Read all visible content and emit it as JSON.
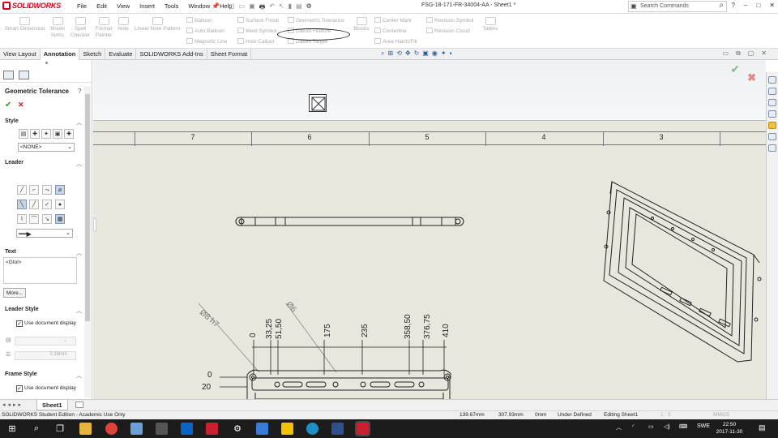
{
  "app": {
    "logo": "SOLIDWORKS",
    "menu": [
      "File",
      "Edit",
      "View",
      "Insert",
      "Tools",
      "Window",
      "Help"
    ],
    "doc_title": "FSG-18-171-FR-34004-AA - Sheet1 *",
    "search_placeholder": "Search Commands",
    "window_controls": [
      "?",
      "–",
      "□",
      "✕"
    ]
  },
  "command_manager": {
    "large": [
      {
        "label": "Smart Dimension"
      },
      {
        "label": "Model Items"
      },
      {
        "label": "Spell Checker"
      },
      {
        "label": "Format Painter"
      },
      {
        "label": "Note"
      },
      {
        "label": "Linear Note Pattern"
      }
    ],
    "small_col1": [
      "Balloon",
      "Auto Balloon",
      "Magnetic Line"
    ],
    "small_col2": [
      "Surface Finish",
      "Weld Symbol",
      "Hole Callout"
    ],
    "small_col3": [
      "Geometric Tolerance",
      "Datum Feature",
      "Datum Target"
    ],
    "blocks": "Blocks",
    "small_col4": [
      "Center Mark",
      "Centerline",
      "Area Hatch/Fill"
    ],
    "small_col5": [
      "Revision Symbol",
      "Revision Cloud"
    ],
    "tables": "Tables"
  },
  "tabs": [
    "View Layout",
    "Annotation",
    "Sketch",
    "Evaluate",
    "SOLIDWORKS Add-Ins",
    "Sheet Format"
  ],
  "active_tab": "Annotation",
  "property_manager": {
    "title": "Geometric Tolerance",
    "help": "?",
    "style": {
      "heading": "Style",
      "dropdown": "<NONE>"
    },
    "leader": {
      "heading": "Leader"
    },
    "text": {
      "heading": "Text",
      "value": "<Gtol>",
      "more_button": "More..."
    },
    "leader_style": {
      "heading": "Leader Style",
      "checkbox": "Use document display",
      "thickness": "0.18mm"
    },
    "frame_style": {
      "heading": "Frame Style",
      "checkbox": "Use document display"
    }
  },
  "drawing": {
    "zones": [
      "7",
      "6",
      "5",
      "4",
      "3"
    ],
    "dim_diameters": [
      "Ø8 h7",
      "Ø6"
    ],
    "dim_horizontal": [
      "0",
      "33,25",
      "51,50",
      "175",
      "235",
      "358,50",
      "376,75",
      "410"
    ],
    "dim_vertical": [
      "0",
      "20"
    ]
  },
  "sheet_tab": "Sheet1",
  "status": {
    "edition": "SOLIDWORKS Student Edition - Academic Use Only",
    "x": "139.67mm",
    "y": "307.93mm",
    "z": "0mm",
    "state": "Under Defined",
    "editing": "Editing Sheet1",
    "scale": "1 : 5",
    "units": "MMGS"
  },
  "taskbar": {
    "lang": "SWE",
    "time": "22:50",
    "date": "2017-11-30"
  },
  "colors": {
    "brand": "#d0021b",
    "canvas": "#e7e7dd",
    "taskbar": "#1c1c1c"
  }
}
